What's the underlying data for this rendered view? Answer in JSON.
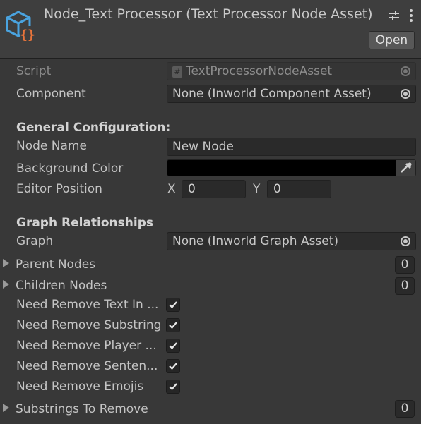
{
  "header": {
    "title": "Node_Text Processor (Text Processor Node Asset)",
    "open_label": "Open"
  },
  "fields": {
    "script_label": "Script",
    "script_value": "TextProcessorNodeAsset",
    "component_label": "Component",
    "component_value": "None (Inworld Component Asset)"
  },
  "general": {
    "heading": "General Configuration:",
    "node_name_label": "Node Name",
    "node_name_value": "New Node",
    "bg_color_label": "Background Color",
    "bg_color_value": "#000000",
    "editor_position_label": "Editor Position",
    "x_label": "X",
    "x_value": "0",
    "y_label": "Y",
    "y_value": "0"
  },
  "graph": {
    "heading": "Graph Relationships",
    "graph_label": "Graph",
    "graph_value": "None (Inworld Graph Asset)",
    "parent_nodes_label": "Parent Nodes",
    "parent_nodes_count": "0",
    "children_nodes_label": "Children Nodes",
    "children_nodes_count": "0"
  },
  "toggles": [
    {
      "label": "Need Remove Text In ...",
      "checked": true
    },
    {
      "label": "Need Remove Substring",
      "checked": true
    },
    {
      "label": "Need Remove Player ...",
      "checked": true
    },
    {
      "label": "Need Remove Senten...",
      "checked": true
    },
    {
      "label": "Need Remove Emojis",
      "checked": true
    }
  ],
  "substrings": {
    "label": "Substrings To Remove",
    "count": "0"
  },
  "colors": {
    "accent_orange": "#e8743b",
    "icon_blue": "#4aa3df"
  }
}
